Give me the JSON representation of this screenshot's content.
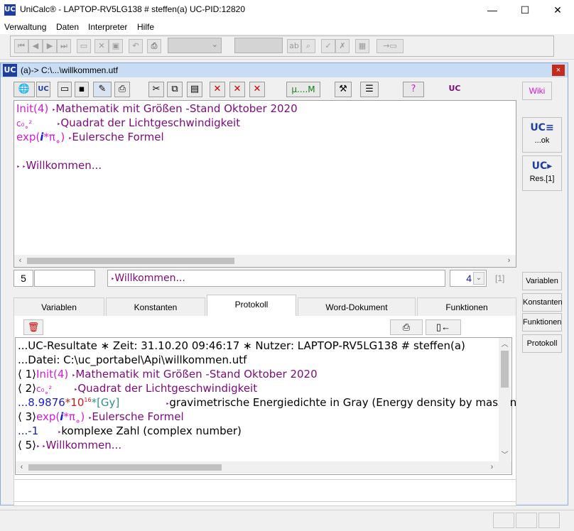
{
  "window": {
    "title": "UniCalc® - LAPTOP-RV5LG138 # steffen(a) UC-PID:12820",
    "logo_text": "UC",
    "minimize": "—",
    "maximize": "☐",
    "close": "✕"
  },
  "menu": [
    "Verwaltung",
    "Daten",
    "Interpreter",
    "Hilfe"
  ],
  "child": {
    "logo_text": "UC",
    "title": "(a)-> C:\\...\\willkommen.utf",
    "close": "×"
  },
  "child_toolbar": {
    "mu_label": "µ....M",
    "help_label": "?",
    "uc_label": "UC"
  },
  "editor": {
    "lines": [
      {
        "code": "Init(4)",
        "marker": "‣",
        "text": "Mathematik mit Größen -Stand Oktober 2020"
      },
      {
        "code": "c₀˳²",
        "marker": "‣",
        "text": "Quadrat der Lichtgeschwindigkeit"
      },
      {
        "code_prefix": "exp(",
        "code_i": "i",
        "code_rest": "*π˳)",
        "marker": "‣",
        "text": "Eulersche Formel"
      },
      {
        "marker": "‣ ‣",
        "text": "Willkommen..."
      }
    ]
  },
  "right_panel": {
    "wiki": "Wiki",
    "ok_label": "...ok",
    "res_label": "Res.[1]",
    "variablen": "Variablen",
    "konstanten": "Konstanten",
    "funktionen": "Funktionen",
    "protokoll": "Protokoll"
  },
  "inputline": {
    "line_number": "5",
    "text": "Willkommen...",
    "marker": "‣",
    "count_value": "4",
    "result_index": "[1]"
  },
  "tabs": [
    {
      "label": "Variablen",
      "active": false
    },
    {
      "label": "Konstanten",
      "active": false
    },
    {
      "label": "Protokoll",
      "active": true
    },
    {
      "label": "Word-Dokument",
      "active": false
    },
    {
      "label": "Funktionen",
      "active": false
    }
  ],
  "protocol": {
    "header": "...UC-Resultate ∗ Zeit: 31.10.20 09:46:17 ∗ Nutzer: LAPTOP-RV5LG138 # steffen(a)",
    "file": "...Datei: C:\\uc_portabel\\Api\\willkommen.utf",
    "entries": [
      {
        "prefix": "⟨ 1⟩",
        "code": "Init(4)",
        "text": "Mathematik mit Größen -Stand Oktober 2020"
      },
      {
        "prefix": "⟨ 2⟩",
        "code": "c₀˳²",
        "text": "Quadrat der Lichtgeschwindigkeit"
      },
      {
        "value": "...8.9876",
        "times": "*10",
        "exp": "16",
        "unit": "*[Gy]",
        "text": "gravimetrische Energiedichte in Gray (Energy density by mass in"
      },
      {
        "prefix": "⟨ 3⟩",
        "code": "exp(",
        "code_i": "i",
        "code_rest": "*π˳)",
        "text": "Eulersche Formel"
      },
      {
        "value": "...-1",
        "text": "komplexe Zahl (complex number)"
      },
      {
        "prefix": "⟨ 5⟩",
        "marker": "‣ ‣",
        "text": "Willkommen..."
      }
    ]
  }
}
